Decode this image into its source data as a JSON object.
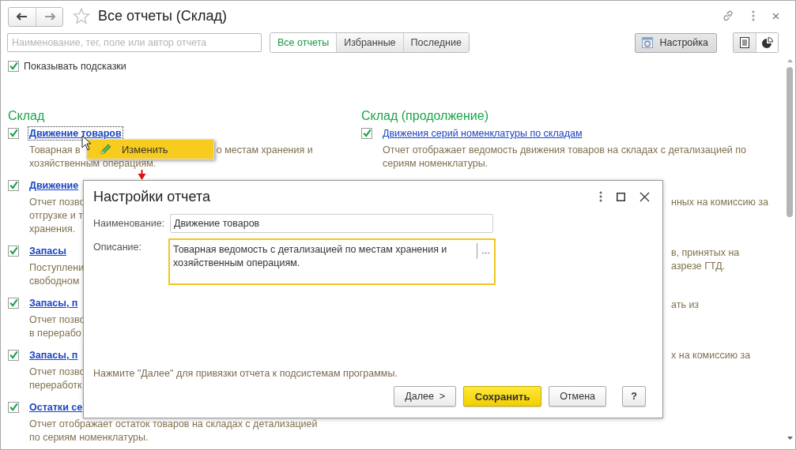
{
  "window": {
    "title": "Все отчеты (Склад)"
  },
  "search": {
    "placeholder": "Наименование, тег, поле или автор отчета"
  },
  "filter_tabs": [
    {
      "label": "Все отчеты",
      "selected": true
    },
    {
      "label": "Избранные",
      "selected": false
    },
    {
      "label": "Последние",
      "selected": false
    }
  ],
  "settings_button": "Настройка",
  "show_hints": {
    "label": "Показывать подсказки",
    "checked": true
  },
  "sections": [
    {
      "title": "Склад",
      "items": [
        {
          "kind": "full",
          "checked": true,
          "link": "Движение товаров",
          "lines": [
            [
              "Товарная в",
              "о местам хранения и"
            ],
            [
              "хозяйственным операциям."
            ]
          ]
        },
        {
          "kind": "full",
          "checked": true,
          "link": "Движение",
          "lines": [
            [
              "Отчет позво"
            ],
            [
              "отгрузке и т"
            ],
            [
              "хранения."
            ]
          ]
        },
        {
          "kind": "full",
          "checked": true,
          "link": "Запасы",
          "lines": [
            [
              "Поступлени"
            ],
            [
              "свободном"
            ]
          ]
        },
        {
          "kind": "full",
          "checked": true,
          "link": "Запасы, п",
          "lines": [
            [
              "Отчет позво"
            ],
            [
              "в перерабо"
            ]
          ]
        },
        {
          "kind": "full",
          "checked": true,
          "link": "Запасы, п",
          "lines": [
            [
              "Отчет позво"
            ],
            [
              "переработк"
            ]
          ]
        },
        {
          "kind": "full",
          "checked": true,
          "link": "Остатки се",
          "lines": [
            [
              "Отчет отображает остаток товаров на складах с детализацией"
            ],
            [
              "по сериям номенклатуры."
            ]
          ]
        }
      ]
    },
    {
      "title": "Склад (продолжение)",
      "items": [
        {
          "kind": "full",
          "checked": true,
          "link": "Движения серий номенклатуры по складам",
          "lines": [
            [
              "Отчет отображает ведомость движения товаров на складах с детализацией по"
            ],
            [
              "сериям номенклатуры."
            ]
          ]
        },
        {
          "kind": "covered",
          "lines": [
            [
              "нных на комиссию за"
            ]
          ]
        },
        {
          "kind": "covered",
          "lines": [
            [
              "в, принятых на"
            ],
            [
              "азрезе ГТД."
            ]
          ]
        },
        {
          "kind": "covered",
          "lines": [
            [
              "ать из"
            ]
          ]
        },
        {
          "kind": "covered",
          "lines": [
            [
              "х на комиссию за"
            ]
          ]
        }
      ]
    }
  ],
  "context_menu": {
    "items": [
      "Изменить"
    ]
  },
  "dialog": {
    "title": "Настройки отчета",
    "name_label": "Наименование:",
    "name_value": "Движение товаров",
    "description_label": "Описание:",
    "description_value": "Товарная ведомость с детализацией по местам хранения и хозяйственным операциям.",
    "hint": "Нажмите \"Далее\" для привязки отчета к подсистемам программы.",
    "buttons": [
      {
        "kind": "default",
        "label": "Далее  >"
      },
      {
        "kind": "primary",
        "label": "Сохранить"
      },
      {
        "kind": "default",
        "label": "Отмена"
      },
      {
        "kind": "help",
        "label": "?"
      }
    ]
  }
}
